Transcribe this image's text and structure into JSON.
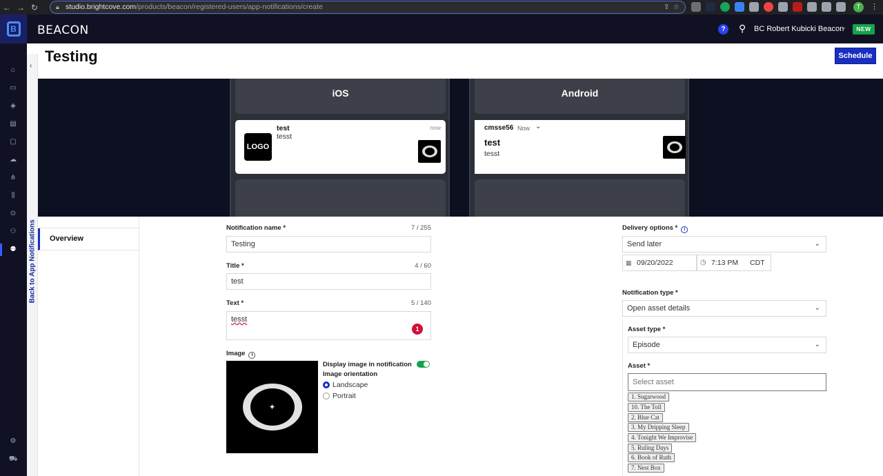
{
  "browser": {
    "url_host": "studio.brightcove.com",
    "url_path": "/products/beacon/registered-users/app-notifications/create",
    "profile_initial": "T"
  },
  "header": {
    "brand": "BEACON",
    "help": "?",
    "user": "BC Robert Kubicki Beacon",
    "new_badge": "NEW"
  },
  "sidebar": {
    "back_label": "Back to App Notifications",
    "overview": "Overview"
  },
  "page": {
    "title": "Testing",
    "schedule_button": "Schedule"
  },
  "preview": {
    "ios": {
      "label": "iOS",
      "logo": "LOGO",
      "title": "test",
      "body": "tesst",
      "time": "now"
    },
    "android": {
      "label": "Android",
      "app": "cmsse56",
      "time": "Now",
      "title": "test",
      "body": "tesst"
    }
  },
  "form": {
    "name_label": "Notification name *",
    "name_count": "7 / 255",
    "name_value": "Testing",
    "title_label": "Title *",
    "title_count": "4 / 60",
    "title_value": "test",
    "text_label": "Text *",
    "text_count": "5 / 140",
    "text_value": "tesst",
    "text_badge": "1",
    "image_label": "Image",
    "display_image_label": "Display image in notification",
    "display_image_on": true,
    "orientation_label": "Image orientation",
    "orientation_options": [
      "Landscape",
      "Portrait"
    ],
    "orientation_selected": "Landscape"
  },
  "delivery": {
    "label": "Delivery options *",
    "value": "Send later",
    "date": "09/20/2022",
    "time": "7:13 PM",
    "tz": "CDT"
  },
  "notification_type": {
    "label": "Notification type *",
    "value": "Open asset details"
  },
  "asset": {
    "type_label": "Asset type *",
    "type_value": "Episode",
    "asset_label": "Asset *",
    "placeholder": "Select asset",
    "options": [
      "1. Sugarwood",
      "10. The Toll",
      "2. Blue Cat",
      "3. My Dripping Sleep",
      "4. Tonight We Improvise",
      "5. Ruling Days",
      "6. Book of Ruth",
      "7. Nest Box"
    ]
  },
  "colors": {
    "brand_blue": "#1a2fc0",
    "header_bg": "#101223",
    "toggle_on": "#16a34a",
    "badge_red": "#d0103a"
  }
}
